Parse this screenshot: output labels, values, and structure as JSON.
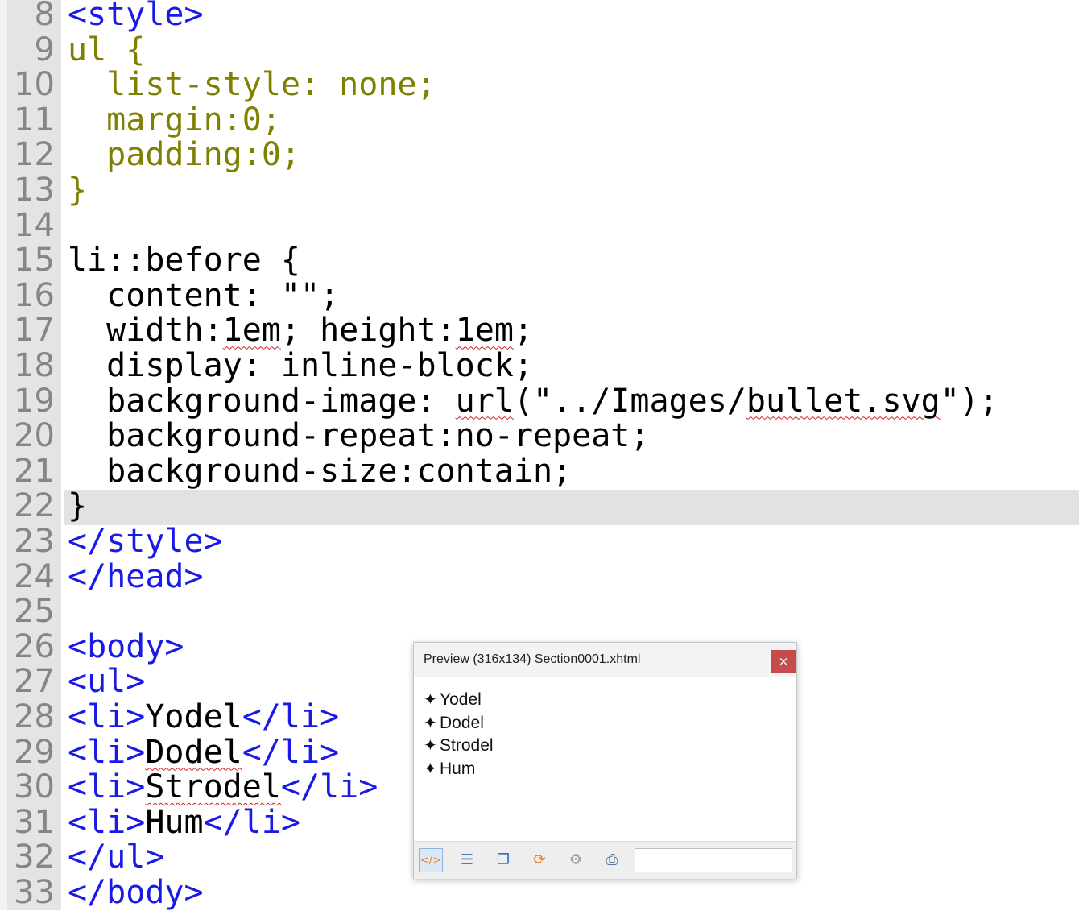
{
  "editor": {
    "lines": [
      {
        "n": "8",
        "segments": [
          {
            "t": "<style>",
            "c": "tag"
          }
        ]
      },
      {
        "n": "9",
        "segments": [
          {
            "t": "ul {",
            "c": "prop"
          }
        ]
      },
      {
        "n": "10",
        "segments": [
          {
            "t": "  list-style: none;",
            "c": "prop"
          }
        ]
      },
      {
        "n": "11",
        "segments": [
          {
            "t": "  margin:0;",
            "c": "prop"
          }
        ]
      },
      {
        "n": "12",
        "segments": [
          {
            "t": "  padding:0;",
            "c": "prop"
          }
        ]
      },
      {
        "n": "13",
        "segments": [
          {
            "t": "}",
            "c": "prop"
          }
        ]
      },
      {
        "n": "14",
        "segments": []
      },
      {
        "n": "15",
        "segments": [
          {
            "t": "li::before {",
            "c": "plain"
          }
        ]
      },
      {
        "n": "16",
        "segments": [
          {
            "t": "  content: \"\";",
            "c": "plain"
          }
        ]
      },
      {
        "n": "17",
        "segments": [
          {
            "t": "  width:",
            "c": "plain"
          },
          {
            "t": "1em",
            "c": "plain",
            "s": true
          },
          {
            "t": "; height:",
            "c": "plain"
          },
          {
            "t": "1em",
            "c": "plain",
            "s": true
          },
          {
            "t": ";",
            "c": "plain"
          }
        ]
      },
      {
        "n": "18",
        "segments": [
          {
            "t": "  display: inline-block;",
            "c": "plain"
          }
        ]
      },
      {
        "n": "19",
        "segments": [
          {
            "t": "  background-image: ",
            "c": "plain"
          },
          {
            "t": "url",
            "c": "plain",
            "s": true
          },
          {
            "t": "(\"../Images/",
            "c": "plain"
          },
          {
            "t": "bullet.svg",
            "c": "plain",
            "s": true
          },
          {
            "t": "\");",
            "c": "plain"
          }
        ]
      },
      {
        "n": "20",
        "segments": [
          {
            "t": "  background-repeat:no-repeat;",
            "c": "plain"
          }
        ]
      },
      {
        "n": "21",
        "segments": [
          {
            "t": "  background-size:contain;",
            "c": "plain"
          }
        ]
      },
      {
        "n": "22",
        "segments": [
          {
            "t": "}",
            "c": "plain"
          }
        ]
      },
      {
        "n": "23",
        "segments": [
          {
            "t": "</style>",
            "c": "tag"
          }
        ]
      },
      {
        "n": "24",
        "segments": [
          {
            "t": "</head>",
            "c": "tag"
          }
        ]
      },
      {
        "n": "25",
        "segments": []
      },
      {
        "n": "26",
        "segments": [
          {
            "t": "<body>",
            "c": "tag"
          }
        ]
      },
      {
        "n": "27",
        "segments": [
          {
            "t": "<ul>",
            "c": "tag"
          }
        ]
      },
      {
        "n": "28",
        "segments": [
          {
            "t": "<li>",
            "c": "tag"
          },
          {
            "t": "Yodel",
            "c": "plain"
          },
          {
            "t": "</li>",
            "c": "tag"
          }
        ]
      },
      {
        "n": "29",
        "segments": [
          {
            "t": "<li>",
            "c": "tag"
          },
          {
            "t": "Dodel",
            "c": "plain",
            "s": true
          },
          {
            "t": "</li>",
            "c": "tag"
          }
        ]
      },
      {
        "n": "30",
        "segments": [
          {
            "t": "<li>",
            "c": "tag"
          },
          {
            "t": "Strodel",
            "c": "plain",
            "s": true
          },
          {
            "t": "</li>",
            "c": "tag"
          }
        ]
      },
      {
        "n": "31",
        "segments": [
          {
            "t": "<li>",
            "c": "tag"
          },
          {
            "t": "Hum",
            "c": "plain"
          },
          {
            "t": "</li>",
            "c": "tag"
          }
        ]
      },
      {
        "n": "32",
        "segments": [
          {
            "t": "</ul>",
            "c": "tag"
          }
        ]
      },
      {
        "n": "33",
        "segments": [
          {
            "t": "</body>",
            "c": "tag"
          }
        ]
      }
    ],
    "current_line": "22"
  },
  "preview": {
    "title": "Preview (316x134) Section0001.xhtml",
    "close_label": "×",
    "bullet_glyph": "✦",
    "items": [
      "Yodel",
      "Dodel",
      "Strodel",
      "Hum"
    ],
    "toolbar": [
      {
        "name": "code-view-icon",
        "glyph": "</>",
        "color": "#f08020",
        "active": true
      },
      {
        "name": "text-view-icon",
        "glyph": "☰",
        "color": "#4a7ec0",
        "active": false
      },
      {
        "name": "copy-icon",
        "glyph": "❐",
        "color": "#2f6fcf",
        "active": false
      },
      {
        "name": "refresh-icon",
        "glyph": "⟳",
        "color": "#f07020",
        "active": false
      },
      {
        "name": "css-toggle-icon",
        "glyph": "⚙",
        "color": "#9a9a9a",
        "active": false
      },
      {
        "name": "print-icon",
        "glyph": "⎙",
        "color": "#5a7a9a",
        "active": false
      }
    ],
    "search_placeholder": ""
  }
}
